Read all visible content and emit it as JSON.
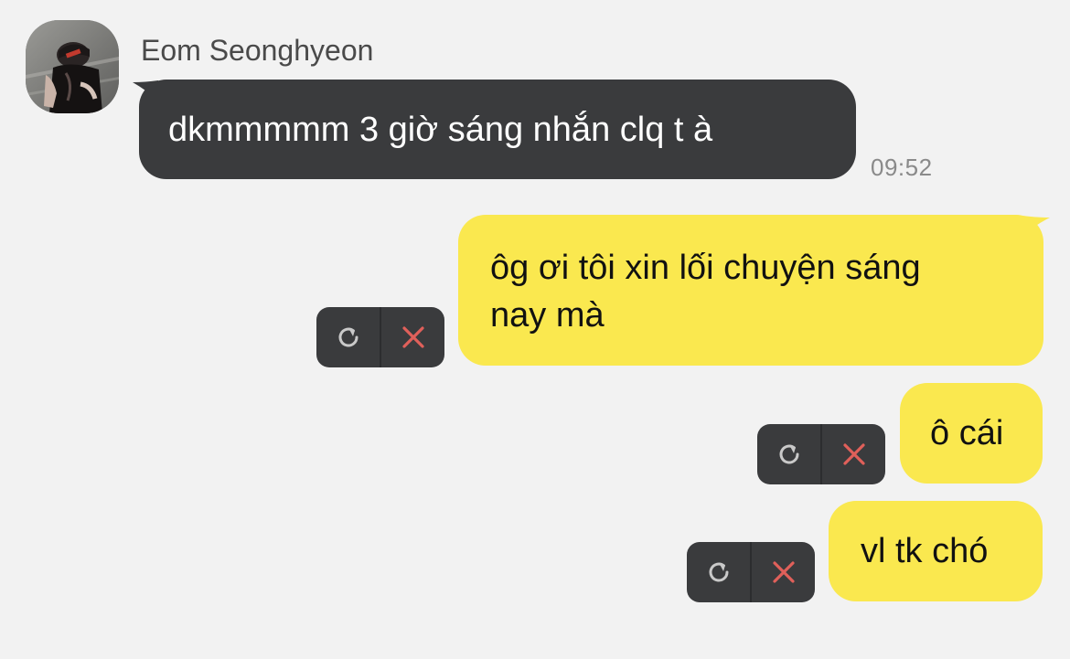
{
  "conversation": {
    "sender": {
      "name": "Eom Seonghyeon",
      "avatar": "profile-photo"
    },
    "messages": [
      {
        "direction": "incoming",
        "text": "dkmmmmm 3 giờ sáng nhắn clq t à",
        "time": "09:52"
      },
      {
        "direction": "outgoing",
        "lines": [
          "ôg ơi tôi xin lối chuyện sáng",
          "nay mà"
        ],
        "status": "failed",
        "actions": [
          "retry-icon",
          "delete-icon"
        ]
      },
      {
        "direction": "outgoing",
        "text": "ô cái",
        "status": "failed",
        "actions": [
          "retry-icon",
          "delete-icon"
        ]
      },
      {
        "direction": "outgoing",
        "text": "vl tk chó",
        "status": "failed",
        "actions": [
          "retry-icon",
          "delete-icon"
        ]
      }
    ]
  },
  "colors": {
    "background": "#f2f2f2",
    "incoming_bubble": "#3a3b3d",
    "outgoing_bubble": "#fae84f",
    "delete_icon": "#e0605a",
    "retry_icon": "#c9c9c9"
  }
}
